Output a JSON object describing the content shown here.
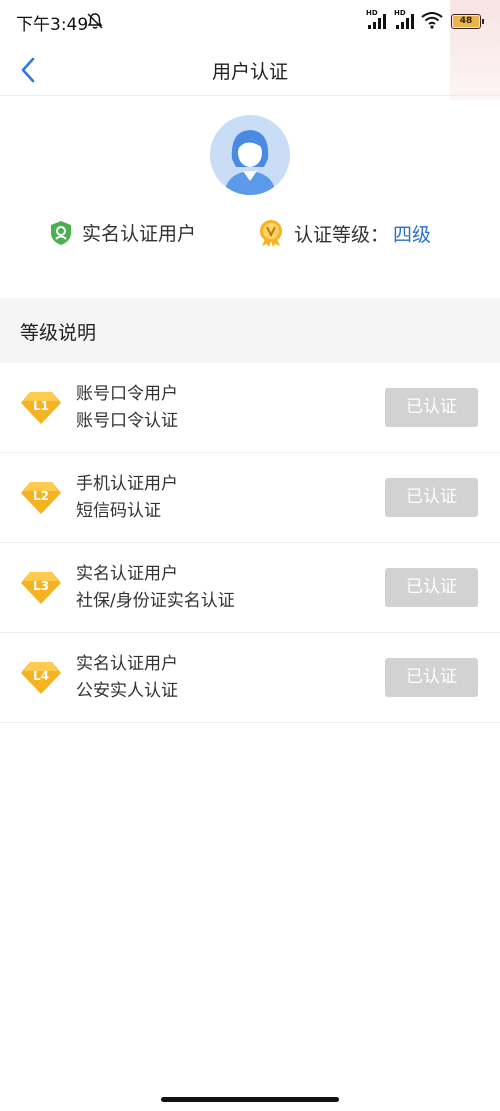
{
  "status_bar": {
    "time": "下午3:49",
    "signal_labels": [
      "HD",
      "HD"
    ],
    "battery": "48",
    "icons": [
      "bell-off-icon",
      "signal-icon",
      "signal-icon",
      "wifi-icon",
      "battery-icon"
    ]
  },
  "nav": {
    "title": "用户认证",
    "back_icon": "chevron-left-icon"
  },
  "profile": {
    "avatar_icon": "user-avatar-icon",
    "real_name_label": "实名认证用户",
    "level_label": "认证等级：",
    "level_value": "四级",
    "colors": {
      "shield": "#4caf50",
      "medal": "#f5b324",
      "level_value": "#2a72c8"
    }
  },
  "section": {
    "title": "等级说明"
  },
  "levels": [
    {
      "badge": "L1",
      "name": "账号口令用户",
      "desc": "账号口令认证",
      "status": "已认证"
    },
    {
      "badge": "L2",
      "name": "手机认证用户",
      "desc": "短信码认证",
      "status": "已认证"
    },
    {
      "badge": "L3",
      "name": "实名认证用户",
      "desc": "社保/身份证实名认证",
      "status": "已认证"
    },
    {
      "badge": "L4",
      "name": "实名认证用户",
      "desc": "公安实人认证",
      "status": "已认证"
    }
  ],
  "colors": {
    "accent": "#2a72c8",
    "badge_gold": "#f5b324",
    "button_disabled": "#d2d2d2"
  }
}
